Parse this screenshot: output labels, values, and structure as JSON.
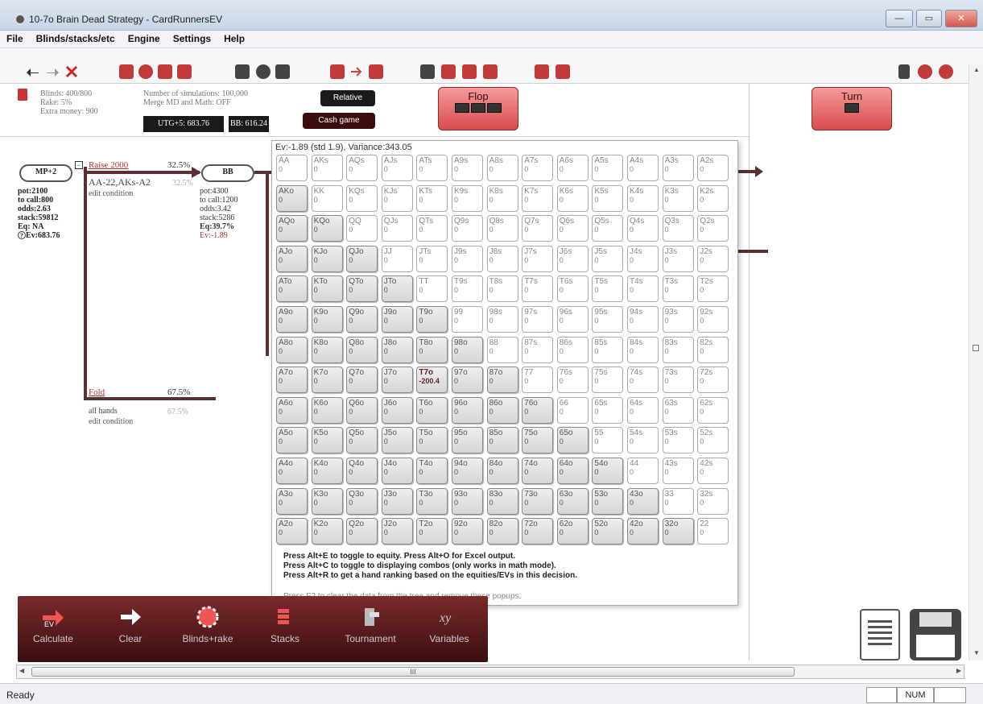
{
  "window": {
    "title": "10-7o Brain Dead Strategy - CardRunnersEV",
    "minimize": "—",
    "maximize": "▭",
    "close": "✕"
  },
  "menu": [
    "File",
    "Blinds/stacks/etc",
    "Engine",
    "Settings",
    "Help"
  ],
  "info": {
    "blinds": "Blinds: 400/800",
    "rake": "Rake: 5%",
    "extra_money": "Extra money: 900",
    "simulations": "Number of simulations: 100,000",
    "merge": "Merge MD and Math: OFF",
    "utg_badge": "UTG+5: 683.76",
    "bb_badge": "BB: 616.24",
    "relative": "Relative",
    "cash_game": "Cash game",
    "flop": "Flop",
    "turn": "Turn"
  },
  "tree": {
    "root": {
      "name": "MP+2",
      "pot": "pot:2100",
      "to_call": "to call:800",
      "odds": "odds:2.63",
      "stack": "stack:59812",
      "eq": "Eq: NA",
      "ev": "Ev:683.76"
    },
    "raise": {
      "label": "Raise 2000",
      "pct": "32.5%",
      "range": "AA-22,AKs-A2",
      "range_pct": "32.5%",
      "edit": "edit condition"
    },
    "fold": {
      "label": "Fold",
      "pct": "67.5%",
      "range": "all hands",
      "range_pct": "67.5%",
      "edit": "edit condition"
    },
    "bb": {
      "name": "BB",
      "pot": "pot:4300",
      "to_call": "to call:1200",
      "odds": "odds:3.42",
      "stack": "stack:5286",
      "eq": "Eq:39.7%",
      "ev": "Ev:-1.89"
    }
  },
  "popup": {
    "header": "Ev:-1.89 (std 1.9), Variance:343.05",
    "rows": [
      [
        "AA",
        "AKs",
        "AQs",
        "AJs",
        "ATs",
        "A9s",
        "A8s",
        "A7s",
        "A6s",
        "A5s",
        "A4s",
        "A3s",
        "A2s"
      ],
      [
        "AKo",
        "KK",
        "KQs",
        "KJs",
        "KTs",
        "K9s",
        "K8s",
        "K7s",
        "K6s",
        "K5s",
        "K4s",
        "K3s",
        "K2s"
      ],
      [
        "AQo",
        "KQo",
        "QQ",
        "QJs",
        "QTs",
        "Q9s",
        "Q8s",
        "Q7s",
        "Q6s",
        "Q5s",
        "Q4s",
        "Q3s",
        "Q2s"
      ],
      [
        "AJo",
        "KJo",
        "QJo",
        "JJ",
        "JTs",
        "J9s",
        "J8s",
        "J7s",
        "J6s",
        "J5s",
        "J4s",
        "J3s",
        "J2s"
      ],
      [
        "ATo",
        "KTo",
        "QTo",
        "JTo",
        "TT",
        "T9s",
        "T8s",
        "T7s",
        "T6s",
        "T5s",
        "T4s",
        "T3s",
        "T2s"
      ],
      [
        "A9o",
        "K9o",
        "Q9o",
        "J9o",
        "T9o",
        "99",
        "98s",
        "97s",
        "96s",
        "95s",
        "94s",
        "93s",
        "92s"
      ],
      [
        "A8o",
        "K8o",
        "Q8o",
        "J8o",
        "T8o",
        "98o",
        "88",
        "87s",
        "86s",
        "85s",
        "84s",
        "83s",
        "82s"
      ],
      [
        "A7o",
        "K7o",
        "Q7o",
        "J7o",
        "T7o",
        "97o",
        "87o",
        "77",
        "76s",
        "75s",
        "74s",
        "73s",
        "72s"
      ],
      [
        "A6o",
        "K6o",
        "Q6o",
        "J6o",
        "T6o",
        "96o",
        "86o",
        "76o",
        "66",
        "65s",
        "64s",
        "63s",
        "62s"
      ],
      [
        "A5o",
        "K5o",
        "Q5o",
        "J5o",
        "T5o",
        "95o",
        "85o",
        "75o",
        "65o",
        "55",
        "54s",
        "53s",
        "52s"
      ],
      [
        "A4o",
        "K4o",
        "Q4o",
        "J4o",
        "T4o",
        "94o",
        "84o",
        "74o",
        "64o",
        "54o",
        "44",
        "43s",
        "42s"
      ],
      [
        "A3o",
        "K3o",
        "Q3o",
        "J3o",
        "T3o",
        "93o",
        "83o",
        "73o",
        "63o",
        "53o",
        "43o",
        "33",
        "32s"
      ],
      [
        "A2o",
        "K2o",
        "Q2o",
        "J2o",
        "T2o",
        "92o",
        "82o",
        "72o",
        "62o",
        "52o",
        "42o",
        "32o",
        "22"
      ]
    ],
    "zero": "0",
    "t7o_value": "-200.4",
    "notes": [
      "Press Alt+E to toggle to equity. Press Alt+O for Excel output.",
      "Press Alt+C to toggle to displaying combos (only works in math mode).",
      "Press Alt+R to get a hand ranking based on the equities/EVs in this decision."
    ],
    "note_light": "Press F2 to clear the data from the tree and remove these popups."
  },
  "actions": [
    "Calculate",
    "Clear",
    "Blinds+rake",
    "Stacks",
    "Tournament",
    "Variables"
  ],
  "scroll_mark": "III",
  "status": {
    "text": "Ready",
    "num": "NUM"
  }
}
